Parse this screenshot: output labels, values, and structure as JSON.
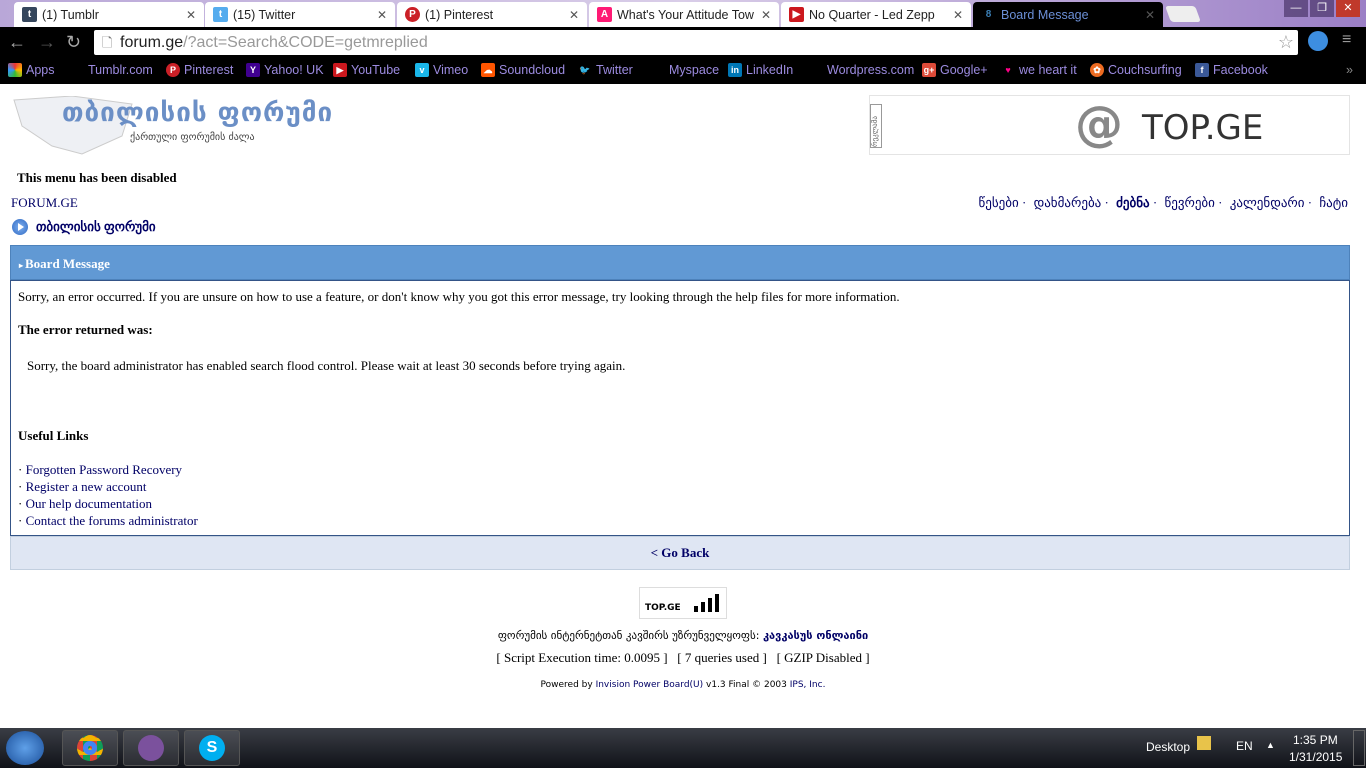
{
  "browser": {
    "tabs": [
      {
        "label": "(1) Tumblr",
        "icon": "tumblr-icon",
        "color": "#35465c",
        "glyph": "t"
      },
      {
        "label": "(15) Twitter",
        "icon": "twitter-icon",
        "color": "#55acee",
        "glyph": "🐦"
      },
      {
        "label": "(1) Pinterest",
        "icon": "pinterest-icon",
        "color": "#cb2027",
        "glyph": "P"
      },
      {
        "label": "What's Your Attitude Tow",
        "icon": "a-icon",
        "color": "#ff1a75",
        "glyph": "A"
      },
      {
        "label": "No Quarter - Led Zepp",
        "icon": "youtube-icon",
        "color": "#cc181e",
        "glyph": "▶"
      },
      {
        "label": "Board Message",
        "icon": "forum-icon",
        "color": "#1f4f7a",
        "glyph": "8"
      }
    ],
    "url_host": "forum.ge",
    "url_path": "/?act=Search&CODE=getmreplied",
    "bookmarks": [
      {
        "label": "Apps",
        "icon": "apps-icon"
      },
      {
        "label": "Tumblr.com"
      },
      {
        "label": "Pinterest",
        "icon": "pinterest-icon"
      },
      {
        "label": "Yahoo! UK",
        "icon": "yahoo-icon"
      },
      {
        "label": "YouTube",
        "icon": "youtube-icon"
      },
      {
        "label": "Vimeo",
        "icon": "vimeo-icon"
      },
      {
        "label": "Soundcloud",
        "icon": "soundcloud-icon"
      },
      {
        "label": "Twitter",
        "icon": "twitter-icon"
      },
      {
        "label": "Myspace"
      },
      {
        "label": "LinkedIn",
        "icon": "linkedin-icon"
      },
      {
        "label": "Wordpress.com"
      },
      {
        "label": "Google+",
        "icon": "googleplus-icon"
      },
      {
        "label": "we heart it",
        "icon": "heart-icon"
      },
      {
        "label": "Couchsurfing",
        "icon": "couchsurfing-icon"
      },
      {
        "label": "Facebook",
        "icon": "facebook-icon"
      }
    ],
    "more": "»"
  },
  "page": {
    "logo_title": "თბილისის ფორუმი",
    "logo_subtitle": "ქართული ფორუმის ძალა",
    "banner_text": "TOP.GE",
    "banner_side": "რეკლამა",
    "disabled_notice": "This menu has been disabled",
    "site_link": "FORUM.GE",
    "nav": [
      "წესები",
      "დახმარება",
      "ძებნა",
      "წევრები",
      "კალენდარი",
      "ჩატი"
    ],
    "breadcrumb": "თბილისის ფორუმი",
    "header": "Board Message",
    "intro": "Sorry, an error occurred. If you are unsure on how to use a feature, or don't know why you got this error message, try looking through the help files for more information.",
    "error_heading": "The error returned was:",
    "error_text": "Sorry, the board administrator has enabled search flood control. Please wait at least 30 seconds before trying again.",
    "links_heading": "Useful Links",
    "links": [
      "Forgotten Password Recovery",
      "Register a new account",
      "Our help documentation",
      "Contact the forums administrator"
    ],
    "go_back": "< Go Back",
    "counter": "TOP.GE",
    "isp_label": "ფორუმის ინტერნეტთან კავშირს უზრუნველყოფს:",
    "isp_name": "კავკასუს ონლაინი",
    "stats": [
      "[ Script Execution time: 0.0095 ]",
      "[ 7 queries used ]",
      "[ GZIP Disabled ]"
    ],
    "powered_prefix": "Powered by ",
    "powered_link": "Invision Power Board(U)",
    "powered_suffix": " v1.3 Final © 2003 ",
    "ips": "IPS, Inc."
  },
  "taskbar": {
    "desktop": "Desktop",
    "lang": "EN",
    "time": "1:35 PM",
    "date": "1/31/2015"
  }
}
